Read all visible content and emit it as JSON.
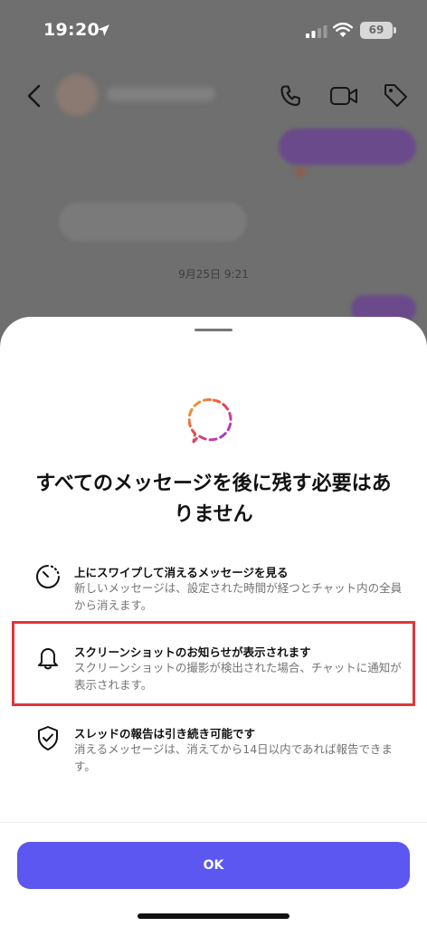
{
  "status_bar": {
    "time": "19:20",
    "battery_level": "69",
    "icons": [
      "location-arrow-icon",
      "signal-icon",
      "wifi-icon",
      "battery-icon"
    ]
  },
  "chat_header": {
    "icons": [
      "back-chevron-icon",
      "phone-icon",
      "video-camera-icon",
      "tag-icon"
    ]
  },
  "chat": {
    "timestamp": "9月25日 9:21"
  },
  "sheet": {
    "title": "すべてのメッセージを後に残す必要はありません",
    "features": [
      {
        "icon": "dashed-timer-icon",
        "title": "上にスワイプして消えるメッセージを見る",
        "description": "新しいメッセージは、設定された時間が経つとチャット内の全員から消えます。"
      },
      {
        "icon": "bell-icon",
        "title": "スクリーンショットのお知らせが表示されます",
        "description": "スクリーンショットの撮影が検出された場合、チャットに通知が表示されます。"
      },
      {
        "icon": "shield-check-icon",
        "title": "スレッドの報告は引き続き可能です",
        "description": "消えるメッセージは、消えてから14日以内であれば報告できます。"
      }
    ],
    "ok_label": "OK"
  },
  "colors": {
    "accent_button": "#5b57f0",
    "highlight_border": "#e0353a",
    "logo_gradient": [
      "#f6b13b",
      "#e8483f",
      "#c13ab2",
      "#8a3ad9"
    ]
  }
}
